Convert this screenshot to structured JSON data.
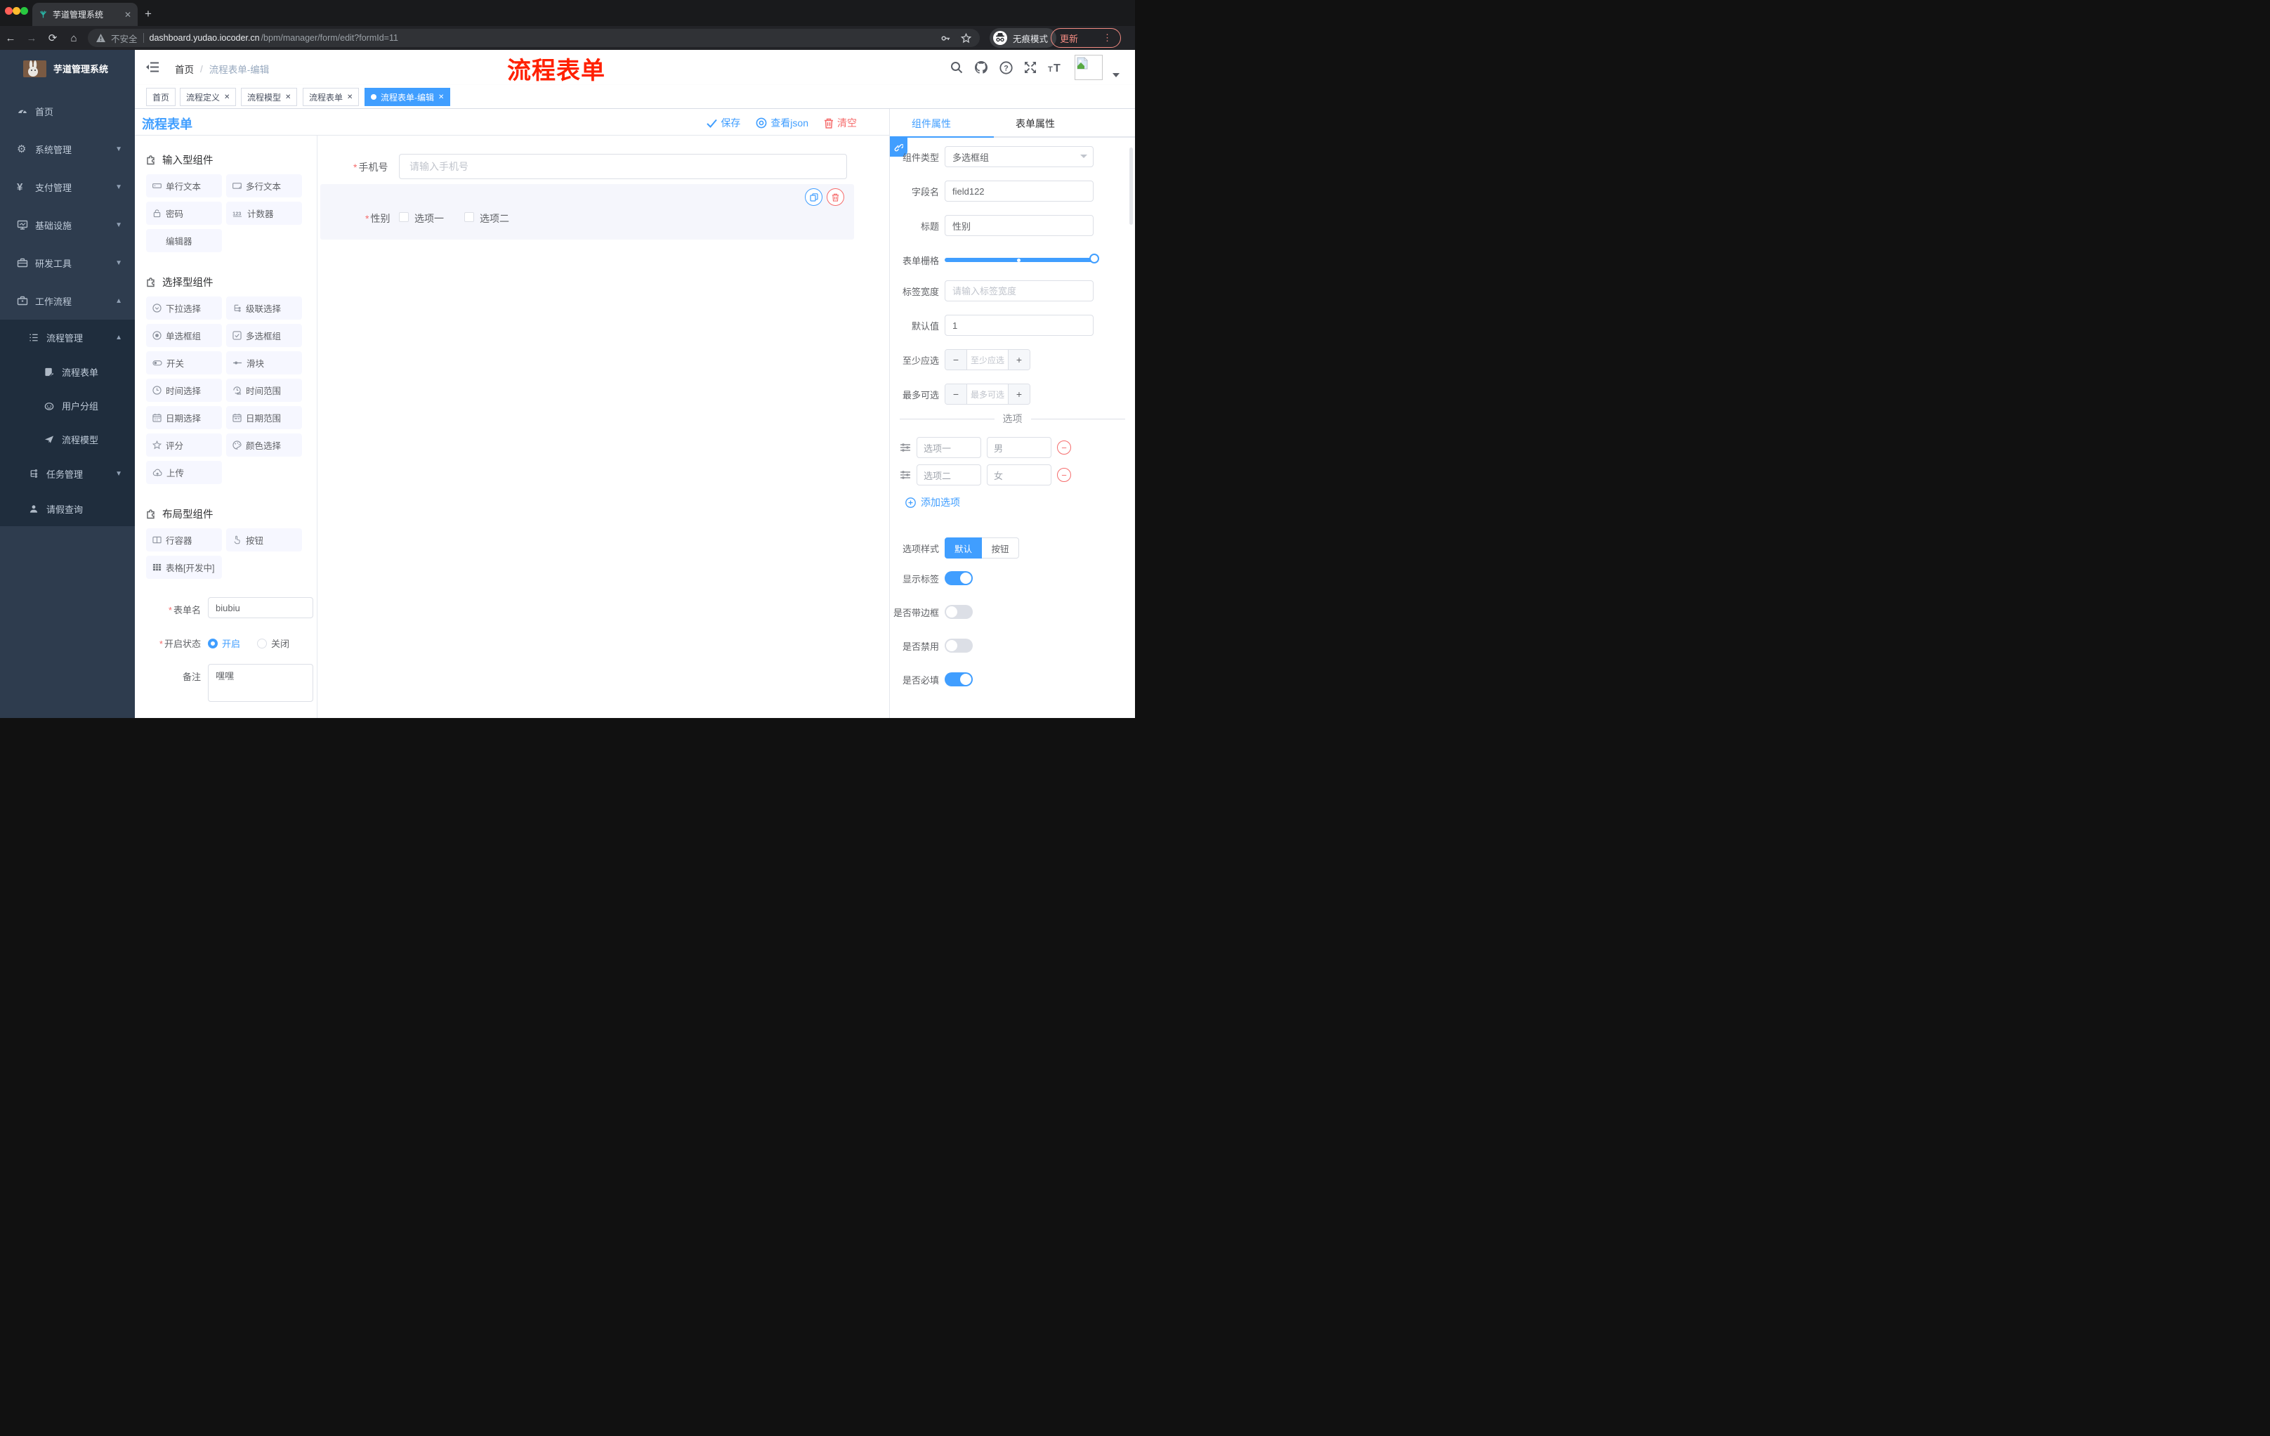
{
  "colors": {
    "primary": "#409eff",
    "danger": "#f56c6c",
    "annotation": "#ff2000",
    "sidebar_bg": "#2e3c4e",
    "submenu_bg": "#1f2d3d"
  },
  "browser": {
    "tab_title": "芋道管理系统",
    "security": "不安全",
    "url_domain": "dashboard.yudao.iocoder.cn",
    "url_path": "/bpm/manager/form/edit?formId=11",
    "incognito": "无痕模式",
    "update": "更新"
  },
  "sidebar": {
    "title": "芋道管理系统",
    "items": [
      "首页",
      "系统管理",
      "支付管理",
      "基础设施",
      "研发工具",
      "工作流程"
    ],
    "submenu": [
      "流程管理",
      "流程表单",
      "用户分组",
      "流程模型",
      "任务管理",
      "请假查询"
    ]
  },
  "header": {
    "breadcrumb_home": "首页",
    "breadcrumb_sep": "/",
    "breadcrumb_current": "流程表单-编辑",
    "annotation": "流程表单"
  },
  "tags": [
    "首页",
    "流程定义",
    "流程模型",
    "流程表单",
    "流程表单-编辑"
  ],
  "designer": {
    "title": "流程表单",
    "save": "保存",
    "view_json": "查看json",
    "clear": "清空"
  },
  "palette": {
    "section_input": "输入型组件",
    "section_select": "选择型组件",
    "section_layout": "布局型组件",
    "input": [
      "单行文本",
      "多行文本",
      "密码",
      "计数器",
      "编辑器"
    ],
    "select": [
      "下拉选择",
      "级联选择",
      "单选框组",
      "多选框组",
      "开关",
      "滑块",
      "时间选择",
      "时间范围",
      "日期选择",
      "日期范围",
      "评分",
      "颜色选择",
      "上传"
    ],
    "layout": [
      "行容器",
      "按钮",
      "表格[开发中]"
    ]
  },
  "meta": {
    "name_label": "表单名",
    "name_value": "biubiu",
    "status_label": "开启状态",
    "status_on": "开启",
    "status_off": "关闭",
    "remark_label": "备注",
    "remark_value": "嘿嘿"
  },
  "canvas": {
    "phone_label": "手机号",
    "phone_placeholder": "请输入手机号",
    "gender_label": "性别",
    "option1": "选项一",
    "option2": "选项二"
  },
  "panel": {
    "tab_component": "组件属性",
    "tab_form": "表单属性",
    "type_label": "组件类型",
    "type_value": "多选框组",
    "field_label": "字段名",
    "field_value": "field122",
    "title_label": "标题",
    "title_value": "性别",
    "grid_label": "表单栅格",
    "width_label": "标签宽度",
    "width_placeholder": "请输入标签宽度",
    "default_label": "默认值",
    "default_value": "1",
    "min_label": "至少应选",
    "min_placeholder": "至少应选",
    "max_label": "最多可选",
    "max_placeholder": "最多可选",
    "options_title": "选项",
    "opt1_label": "选项一",
    "opt1_value": "男",
    "opt2_label": "选项二",
    "opt2_value": "女",
    "add_option": "添加选项",
    "style_label": "选项样式",
    "style_default": "默认",
    "style_button": "按钮",
    "show_label": "显示标签",
    "border_label": "是否带边框",
    "disabled_label": "是否禁用",
    "required_label": "是否必填"
  }
}
